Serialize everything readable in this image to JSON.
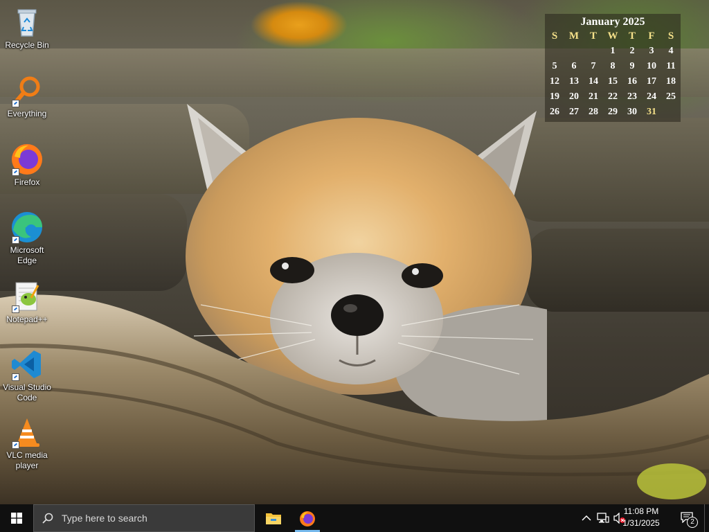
{
  "desktop": {
    "icons": [
      {
        "label": "Recycle Bin"
      },
      {
        "label": "Everything"
      },
      {
        "label": "Firefox"
      },
      {
        "label": "Microsoft Edge"
      },
      {
        "label": "Notepad++"
      },
      {
        "label": "Visual Studio Code"
      },
      {
        "label": "VLC media player"
      }
    ]
  },
  "calendar": {
    "title": "January 2025",
    "weekdays": [
      "S",
      "M",
      "T",
      "W",
      "T",
      "F",
      "S"
    ],
    "days": [
      "",
      "",
      "",
      "1",
      "2",
      "3",
      "4",
      "5",
      "6",
      "7",
      "8",
      "9",
      "10",
      "11",
      "12",
      "13",
      "14",
      "15",
      "16",
      "17",
      "18",
      "19",
      "20",
      "21",
      "22",
      "23",
      "24",
      "25",
      "26",
      "27",
      "28",
      "29",
      "30",
      "31",
      ""
    ],
    "today": "31",
    "header_color": "#f5e18a"
  },
  "taskbar": {
    "search_placeholder": "Type here to search",
    "pinned": [
      {
        "icon": "file-explorer-icon"
      },
      {
        "icon": "firefox-icon"
      }
    ],
    "clock_time": "11:08 PM",
    "clock_date": "1/31/2025",
    "notification_count": "2",
    "accent": "#76b9ed"
  }
}
